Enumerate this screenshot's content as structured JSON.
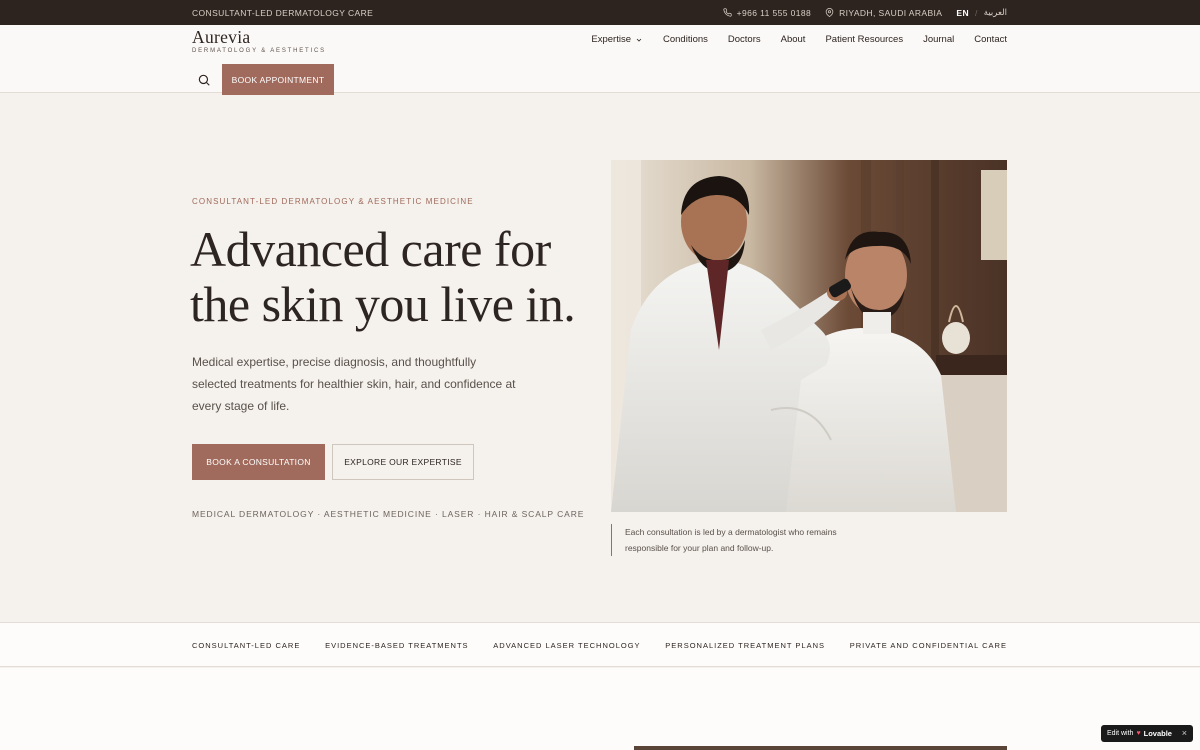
{
  "topbar": {
    "tagline": "CONSULTANT-LED DERMATOLOGY CARE",
    "phone": "+966 11 555 0188",
    "location": "RIYADH, SAUDI ARABIA",
    "lang_en": "EN",
    "lang_sep": "/",
    "lang_ar": "العربية"
  },
  "header": {
    "logo_name": "Aurevia",
    "logo_sub": "DERMATOLOGY & AESTHETICS",
    "nav": [
      "Expertise",
      "Conditions",
      "Doctors",
      "About",
      "Patient Resources",
      "Journal",
      "Contact"
    ],
    "book_label": "BOOK APPOINTMENT"
  },
  "hero": {
    "eyebrow": "CONSULTANT-LED DERMATOLOGY & AESTHETIC MEDICINE",
    "headline_line1": "Advanced care for",
    "headline_line2": "the skin you live in.",
    "subtext": "Medical expertise, precise diagnosis, and thoughtfully selected treatments for healthier skin, hair, and confidence at every stage of life.",
    "cta_primary": "BOOK A CONSULTATION",
    "cta_secondary": "EXPLORE OUR EXPERTISE",
    "services": "MEDICAL DERMATOLOGY · AESTHETIC MEDICINE · LASER · HAIR & SCALP CARE",
    "caption": "Each consultation is led by a dermatologist who remains responsible for your plan and follow-up."
  },
  "features": [
    "CONSULTANT-LED CARE",
    "EVIDENCE-BASED TREATMENTS",
    "ADVANCED LASER TECHNOLOGY",
    "PERSONALIZED TREATMENT PLANS",
    "PRIVATE AND CONFIDENTIAL CARE"
  ],
  "badge": {
    "prefix": "Edit with",
    "brand": "Lovable",
    "close": "×"
  },
  "colors": {
    "accent": "#a06a5c",
    "topbar_bg": "#2d2420",
    "page_bg": "#f5f1ec",
    "text": "#2d2521"
  },
  "icons": [
    "phone-icon",
    "location-pin-icon",
    "chevron-down-icon",
    "search-icon",
    "close-icon"
  ]
}
